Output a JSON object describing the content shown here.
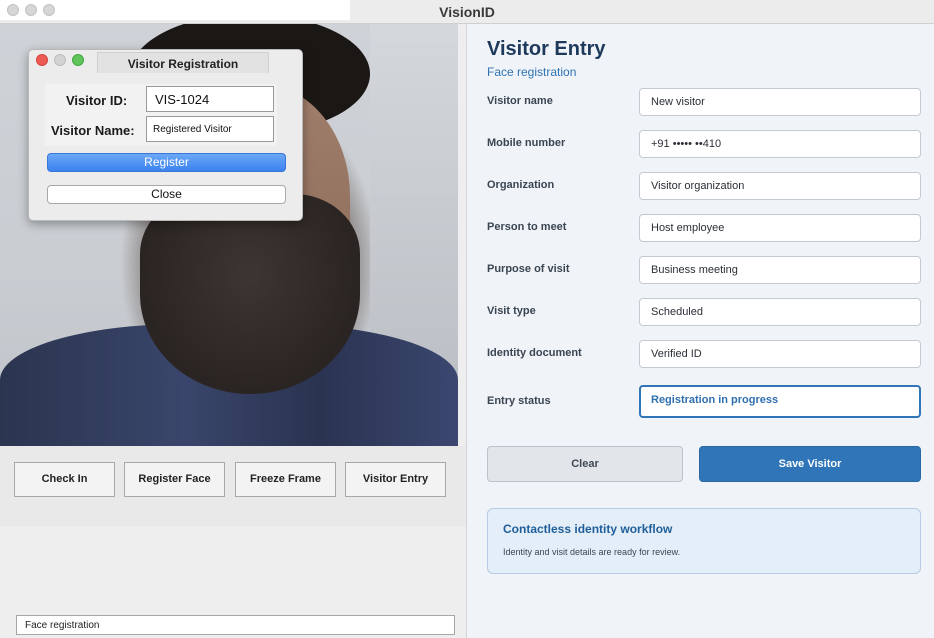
{
  "window": {
    "title": "VisionID"
  },
  "dialog": {
    "title": "Visitor Registration",
    "visitor_id_label": "Visitor ID:",
    "visitor_id_value": "VIS-1024",
    "visitor_name_label": "Visitor Name:",
    "visitor_name_value": "Registered Visitor",
    "register_label": "Register",
    "close_label": "Close"
  },
  "actions": {
    "check_in": "Check In",
    "register_face": "Register Face",
    "freeze_frame": "Freeze Frame",
    "visitor_entry": "Visitor Entry"
  },
  "status_bar": {
    "text": "Face registration"
  },
  "form": {
    "title": "Visitor Entry",
    "subtitle": "Face registration",
    "fields": [
      {
        "label": "Visitor name",
        "value": "New visitor"
      },
      {
        "label": "Mobile number",
        "value": "+91 ••••• ••410"
      },
      {
        "label": "Organization",
        "value": "Visitor organization"
      },
      {
        "label": "Person to meet",
        "value": "Host employee"
      },
      {
        "label": "Purpose of visit",
        "value": "Business meeting"
      },
      {
        "label": "Visit type",
        "value": "Scheduled"
      },
      {
        "label": "Identity document",
        "value": "Verified ID"
      },
      {
        "label": "Entry status",
        "value": "Registration in progress"
      }
    ],
    "clear_label": "Clear",
    "save_label": "Save Visitor"
  },
  "info": {
    "title": "Contactless identity workflow",
    "text": "Identity and visit details are ready for review."
  },
  "colors": {
    "accent": "#2f75b7",
    "title": "#1d3a5c",
    "info_bg": "#e4eef9",
    "register_blue": "#3c82ef"
  }
}
